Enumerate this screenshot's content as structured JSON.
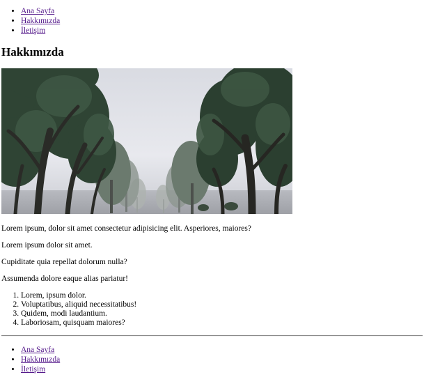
{
  "header": {
    "nav": [
      {
        "label": "Ana Sayfa"
      },
      {
        "label": "Hakkımızda"
      },
      {
        "label": "İletişim"
      }
    ]
  },
  "main": {
    "title": "Hakkımızda",
    "paragraphs": [
      "Lorem ipsum, dolor sit amet consectetur adipisicing elit. Asperiores, maiores?",
      "Lorem ipsum dolor sit amet.",
      "Cupiditate quia repellat dolorum nulla?",
      "Assumenda dolore eaque alias pariatur!"
    ],
    "list": [
      "Lorem, ipsum dolor.",
      "Voluptatibus, aliquid necessitatibus!",
      "Quidem, modi laudantium.",
      "Laboriosam, quisquam maiores?"
    ]
  },
  "footer": {
    "nav": [
      {
        "label": "Ana Sayfa"
      },
      {
        "label": "Hakkımızda"
      },
      {
        "label": "İletişim"
      }
    ]
  },
  "colors": {
    "link_visited": "#551a8b",
    "divider": "#888888"
  }
}
